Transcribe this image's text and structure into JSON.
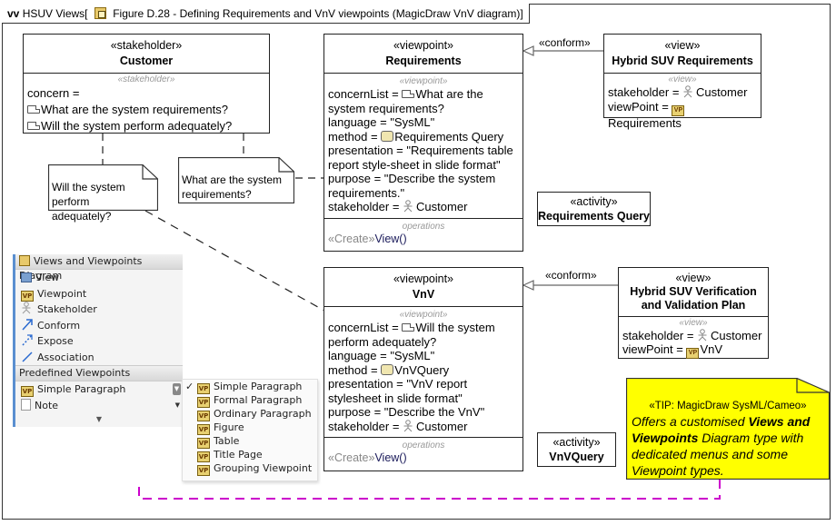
{
  "frame": {
    "kind_label": "vv",
    "package": "HSUV Views[",
    "title": "Figure D.28 - Defining Requirements and VnV viewpoints (MagicDraw VnV diagram)]",
    "icon": "diagram-icon"
  },
  "customer": {
    "stereotype": "«stakeholder»",
    "name": "Customer",
    "compartment_stereotype": "«stakeholder»",
    "concern_label": "concern =",
    "concerns": [
      "What are the system requirements?",
      "Will the system perform adequately?"
    ]
  },
  "notes": {
    "perform": "Will the system perform adequately?",
    "requirements": "What are the system requirements?"
  },
  "vp_requirements": {
    "stereotype": "«viewpoint»",
    "name": "Requirements",
    "compartment_stereotype": "«viewpoint»",
    "concern_prefix": "concernList =",
    "concern_value": "What are the system requirements?",
    "language": "language = \"SysML\"",
    "method_prefix": "method =",
    "method_value": "Requirements Query",
    "presentation": "presentation = \"Requirements table report style-sheet in slide format\"",
    "purpose": "purpose = \"Describe the system requirements.\"",
    "stakeholder_prefix": "stakeholder =",
    "stakeholder_value": "Customer",
    "ops_label": "operations",
    "op_stereotype": "«Create»",
    "op_name": "View()"
  },
  "vp_vnv": {
    "stereotype": "«viewpoint»",
    "name": "VnV",
    "compartment_stereotype": "«viewpoint»",
    "concern_prefix": "concernList =",
    "concern_value": "Will the system perform adequately?",
    "language": "language = \"SysML\"",
    "method_prefix": "method =",
    "method_value": "VnVQuery",
    "presentation": "presentation = \"VnV report stylesheet in slide format\"",
    "purpose": "purpose = \"Describe the VnV\"",
    "stakeholder_prefix": "stakeholder =",
    "stakeholder_value": "Customer",
    "ops_label": "operations",
    "op_stereotype": "«Create»",
    "op_name": "View()"
  },
  "view_req": {
    "stereotype": "«view»",
    "name": "Hybrid SUV Requirements",
    "compartment_stereotype": "«view»",
    "stakeholder_prefix": "stakeholder =",
    "stakeholder_value": "Customer",
    "viewpoint_prefix": "viewPoint =",
    "viewpoint_value": "Requirements"
  },
  "view_vnv": {
    "stereotype": "«view»",
    "name": "Hybrid SUV Verification and Validation Plan",
    "compartment_stereotype": "«view»",
    "stakeholder_prefix": "stakeholder =",
    "stakeholder_value": "Customer",
    "viewpoint_prefix": "viewPoint =",
    "viewpoint_value": "VnV"
  },
  "activity_req": {
    "stereotype": "«activity»",
    "name": "Requirements Query"
  },
  "activity_vnv": {
    "stereotype": "«activity»",
    "name": "VnVQuery"
  },
  "conform_label": "«conform»",
  "vp_icon_text": "VP",
  "palette": {
    "group1": "Views and Viewpoints Diagram",
    "items": [
      {
        "label": "View",
        "icon": "view-icon"
      },
      {
        "label": "Viewpoint",
        "icon": "viewpoint-icon"
      },
      {
        "label": "Stakeholder",
        "icon": "stakeholder-icon"
      },
      {
        "label": "Conform",
        "icon": "conform-icon"
      },
      {
        "label": "Expose",
        "icon": "expose-icon"
      },
      {
        "label": "Association",
        "icon": "association-icon"
      }
    ],
    "group2": "Predefined Viewpoints",
    "predefined": [
      {
        "label": "Simple Paragraph",
        "icon": "viewpoint-icon"
      },
      {
        "label": "Note",
        "icon": "note-icon"
      }
    ]
  },
  "dropdown": {
    "selected": "Simple Paragraph",
    "items": [
      "Simple Paragraph",
      "Formal Paragraph",
      "Ordinary Paragraph",
      "Figure",
      "Table",
      "Title Page",
      "Grouping Viewpoint"
    ]
  },
  "tip": {
    "stereotype": "«TIP: MagicDraw SysML/Cameo»",
    "t1": "Offers a customised ",
    "b1": "Views and Viewpoints",
    "t2": " Diagram type with dedicated menus and some Viewpoint types.",
    "color": "#ffff00"
  },
  "colors": {
    "anchor_line": "#cc00cc"
  }
}
